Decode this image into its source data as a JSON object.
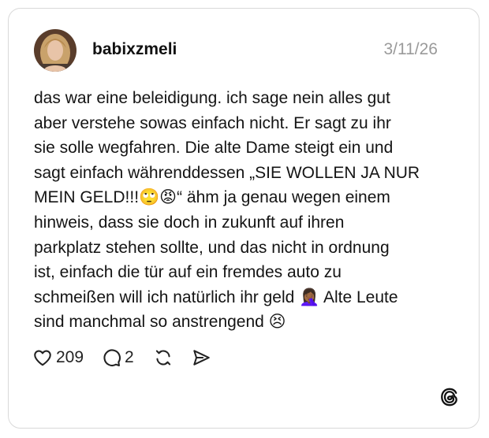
{
  "post": {
    "username": "babixzmeli",
    "date": "3/11/26",
    "text": "das war eine beleidigung. ich sage nein alles gut\naber verstehe sowas einfach nicht. Er sagt zu ihr\nsie solle wegfahren. Die alte Dame steigt ein und\nsagt einfach währenddessen „SIE WOLLEN JA NUR\nMEIN GELD!!!🙄😡“ ähm ja genau wegen einem\nhinweis, dass sie doch in zukunft auf ihren\nparkplatz stehen sollte, und das nicht in ordnung\nist, einfach die tür auf ein fremdes auto zu\nschmeißen will ich natürlich ihr geld 🤦🏾‍♀️ Alte Leute\nsind manchmal so anstrengend 😣",
    "likes": "209",
    "replies": "2"
  },
  "icons": {
    "like": "heart-icon",
    "reply": "comment-bubble-icon",
    "repost": "repost-icon",
    "share": "send-icon",
    "brand": "threads-logo-icon"
  },
  "colors": {
    "text": "#111111",
    "muted": "#9a9a9a",
    "border": "#d9d9d9"
  }
}
